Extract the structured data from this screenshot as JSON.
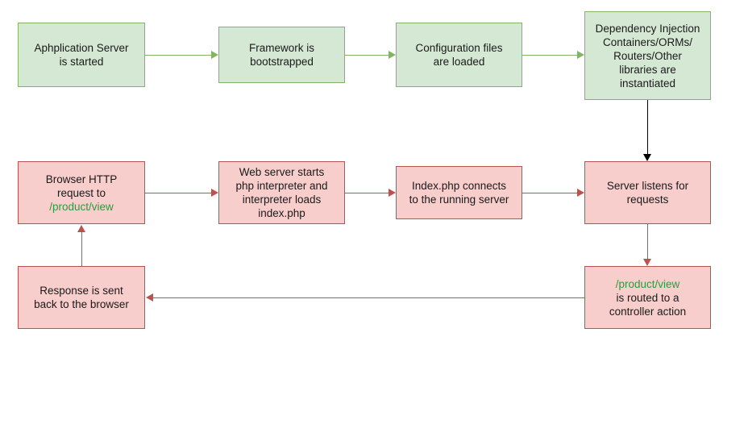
{
  "diagram": {
    "title": "PHP application request lifecycle flowchart",
    "colors": {
      "green_fill": "#d5e8d4",
      "green_stroke": "#82b366",
      "pink_fill": "#f8cecc",
      "pink_stroke": "#b85450",
      "black_stroke": "#000000",
      "route_text": "#2d9a3f"
    },
    "nodes": [
      {
        "id": "app-server-started",
        "text": "Aphplication Server\nis started",
        "style": "green"
      },
      {
        "id": "framework-bootstrapped",
        "text": "Framework is\nbootstrapped",
        "style": "green"
      },
      {
        "id": "config-files-loaded",
        "text": "Configuration files\nare loaded",
        "style": "green"
      },
      {
        "id": "libraries-instantiated",
        "text": "Dependency Injection\nContainers/ORMs/\nRouters/Other\nlibraries are\ninstantiated",
        "style": "green"
      },
      {
        "id": "browser-http-request",
        "text_before": "Browser HTTP\nrequest to\n",
        "route": "/product/view",
        "text_after": "",
        "style": "pink"
      },
      {
        "id": "web-server-starts-php",
        "text": "Web server starts\nphp interpreter and\ninterpreter loads\nindex.php",
        "style": "pink"
      },
      {
        "id": "index-php-connects",
        "text": "Index.php connects\nto the running server",
        "style": "pink"
      },
      {
        "id": "server-listens",
        "text": "Server listens for\nrequests",
        "style": "pink"
      },
      {
        "id": "routed-to-controller",
        "text_before": "",
        "route": "/product/view",
        "text_after": "\nis routed to a\ncontroller action",
        "style": "pink"
      },
      {
        "id": "response-sent-back",
        "text": "Response is sent\nback to the browser",
        "style": "pink"
      }
    ],
    "edges": [
      {
        "id": "app-server-to-framework",
        "color": "green",
        "direction": "right"
      },
      {
        "id": "framework-to-config",
        "color": "green",
        "direction": "right"
      },
      {
        "id": "config-to-libraries",
        "color": "green",
        "direction": "right"
      },
      {
        "id": "libraries-to-server-listens",
        "color": "black",
        "direction": "down"
      },
      {
        "id": "browser-to-web-server",
        "color": "pink",
        "direction": "right"
      },
      {
        "id": "web-server-to-index",
        "color": "pink",
        "direction": "right"
      },
      {
        "id": "index-to-server-listens",
        "color": "pink",
        "direction": "right"
      },
      {
        "id": "server-listens-to-routed",
        "color": "pink",
        "direction": "down"
      },
      {
        "id": "routed-to-response",
        "color": "pink",
        "direction": "left"
      },
      {
        "id": "response-to-browser",
        "color": "pink",
        "direction": "up"
      }
    ]
  }
}
